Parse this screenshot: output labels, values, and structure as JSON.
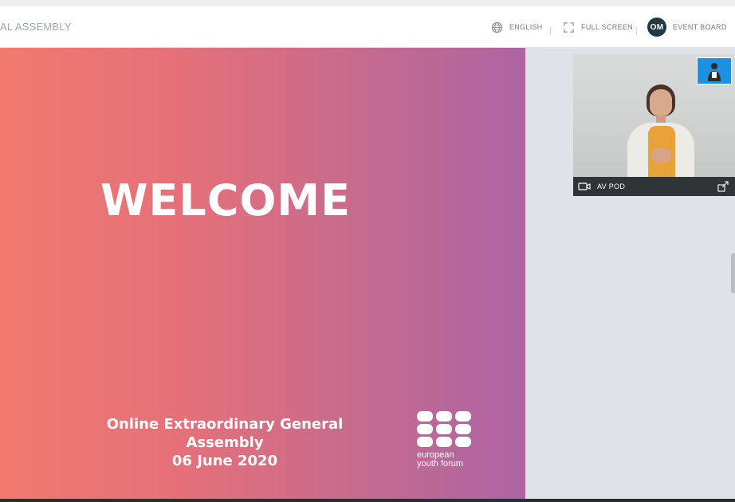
{
  "header": {
    "event_title": "AL ASSEMBLY",
    "language_label": "ENGLISH",
    "fullscreen_label": "FULL SCREEN",
    "user_initials": "OM",
    "event_board_label": "EVENT BOARD"
  },
  "slide": {
    "heading": "WELCOME",
    "subtitle_line1": "Online Extraordinary General Assembly",
    "subtitle_line2": "06 June 2020",
    "logo_line1": "european",
    "logo_line2": "youth forum",
    "gradient_colors": [
      "#f27a6e",
      "#ad64a4"
    ]
  },
  "video_pod": {
    "label": "AV POD",
    "icons": [
      "video-camera-icon",
      "expand-icon",
      "sign-language-interpreter-icon"
    ]
  },
  "colors": {
    "avatar_bg": "#1f3a44",
    "panel_bg": "#dfe3e8",
    "pod_bar": "#2f3439",
    "interpreter_badge": "#1e90e0"
  }
}
